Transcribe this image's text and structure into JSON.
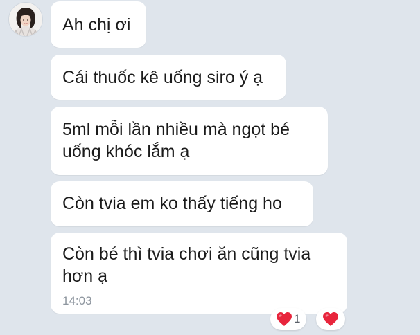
{
  "chat": {
    "messages": [
      {
        "text": "Ah chị ơi"
      },
      {
        "text": "Cái thuốc kê uống siro ý ạ"
      },
      {
        "lines": [
          "5ml mỗi lần nhiều mà ngọt bé",
          "uống khóc lắm ạ"
        ]
      },
      {
        "text": "Còn tvia em ko thấy tiếng ho"
      },
      {
        "lines": [
          "Còn bé thì tvia chơi ăn cũng tvia",
          "hơn ạ"
        ],
        "time": "14:03"
      }
    ],
    "reaction": {
      "icon": "heart-icon",
      "count": "1",
      "color": "#e8253c"
    },
    "react_button": {
      "icon": "heart-icon"
    }
  },
  "colors": {
    "background": "#dfe5ec",
    "bubble": "#ffffff",
    "text": "#1b1b1b",
    "time": "#8e969f"
  }
}
